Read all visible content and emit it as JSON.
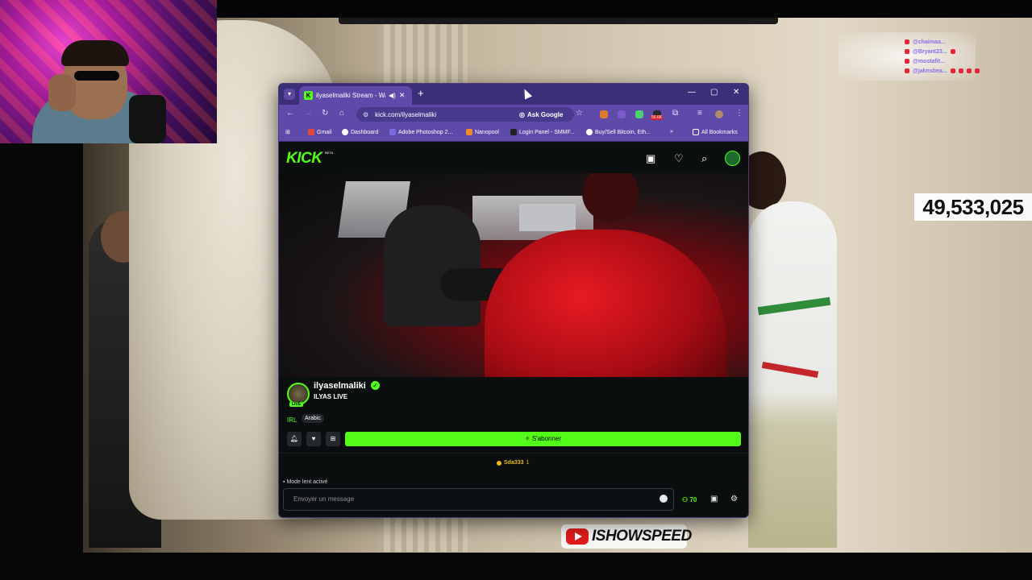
{
  "overlay": {
    "chat": [
      {
        "user": "@chaimaa...",
        "msg": ""
      },
      {
        "user": "@Bryant23...",
        "msg": ""
      },
      {
        "user": "@mostafit...",
        "msg": ""
      },
      {
        "user": "@jaknsbea...",
        "msg": ""
      }
    ],
    "counter": "49,533,025",
    "brand": "ISHOWSPEED"
  },
  "browser": {
    "tab_title": "ilyaselmaliki Stream - Watc",
    "url": "kick.com/ilyaselmaliki",
    "ask_google": "Ask Google",
    "bookmarks": [
      "Gmail",
      "Dashboard",
      "Adobe Photoshop 2...",
      "Nanopool",
      "Login Panel - SMMF...",
      "Buy/Sell Bitcoin, Eth..."
    ],
    "all_bookmarks": "All Bookmarks",
    "extension_badge": "56.6K"
  },
  "kick": {
    "logo": "KICK",
    "beta": "BETA",
    "channel_name": "ilyaselmaliki",
    "stream_title": "ILYAS LIVE",
    "live_badge": "LIVE",
    "category": "IRL",
    "tag": "Arabic",
    "subscribe_label": "S'abonner",
    "gifter_name": "Sda333",
    "gifter_count": "1",
    "slow_mode": "Mode lent activé",
    "message_placeholder": "Envoyer un message",
    "viewers": "70"
  },
  "colors": {
    "kick_green": "#53fc18",
    "browser_theme": "#5e4aa8"
  }
}
